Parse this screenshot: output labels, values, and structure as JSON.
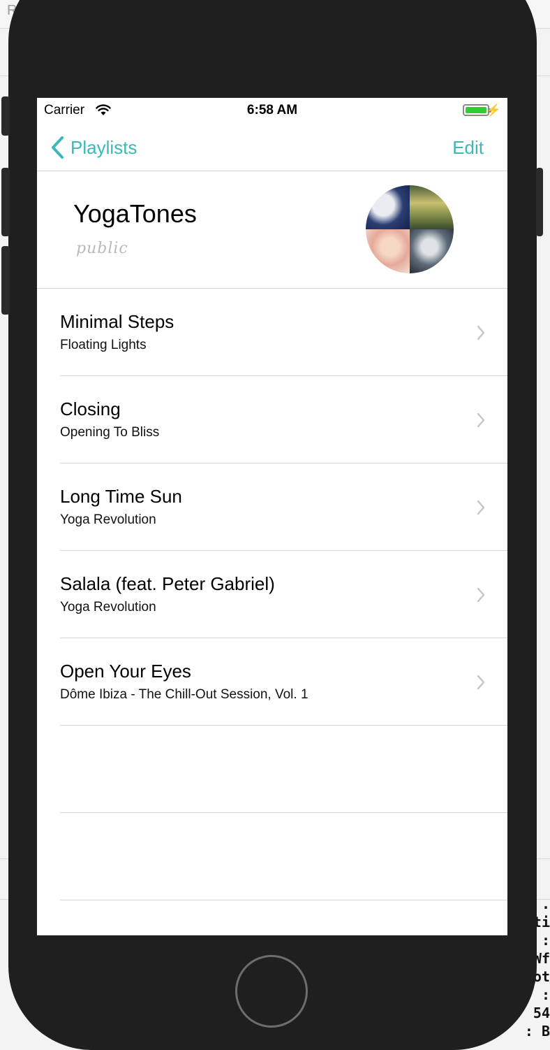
{
  "background": {
    "top_char": "R",
    "console_text": ".\nti\n:\nWf\not\n:\n54\n: B"
  },
  "status_bar": {
    "carrier": "Carrier",
    "time": "6:58 AM",
    "battery_color": "#33cc33"
  },
  "nav": {
    "back_label": "Playlists",
    "edit_label": "Edit",
    "accent_color": "#3cb8b8"
  },
  "playlist": {
    "title": "YogaTones",
    "visibility": "public",
    "cover_icon": "playlist-cover-mosaic"
  },
  "tracks": [
    {
      "title": "Minimal Steps",
      "album": "Floating Lights"
    },
    {
      "title": "Closing",
      "album": "Opening To Bliss"
    },
    {
      "title": "Long Time Sun",
      "album": "Yoga Revolution"
    },
    {
      "title": "Salala (feat. Peter Gabriel)",
      "album": "Yoga Revolution"
    },
    {
      "title": "Open Your Eyes",
      "album": "Dôme Ibiza - The Chill-Out Session, Vol. 1"
    }
  ]
}
